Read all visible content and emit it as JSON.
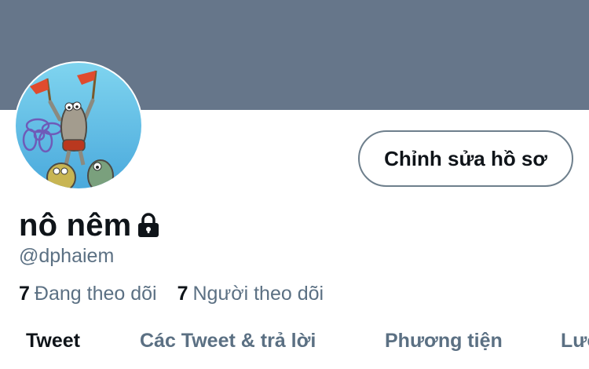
{
  "profile": {
    "display_name": "nô nêm",
    "handle": "@dphaiem",
    "edit_button_label": "Chỉnh sửa hồ sơ",
    "banner_color": "#66768a",
    "locked_icon": "lock-icon"
  },
  "stats": {
    "following_count": "7",
    "following_label": "Đang theo dõi",
    "followers_count": "7",
    "followers_label": "Người theo dõi"
  },
  "tabs": [
    {
      "label": "Tweet",
      "active": true
    },
    {
      "label": "Các Tweet & trả lời",
      "active": false
    },
    {
      "label": "Phương tiện",
      "active": false
    },
    {
      "label": "Lượt thích",
      "active": false
    }
  ],
  "colors": {
    "text_primary": "#0f1419",
    "text_secondary": "#5b7083",
    "button_border": "#6e7f8c"
  }
}
